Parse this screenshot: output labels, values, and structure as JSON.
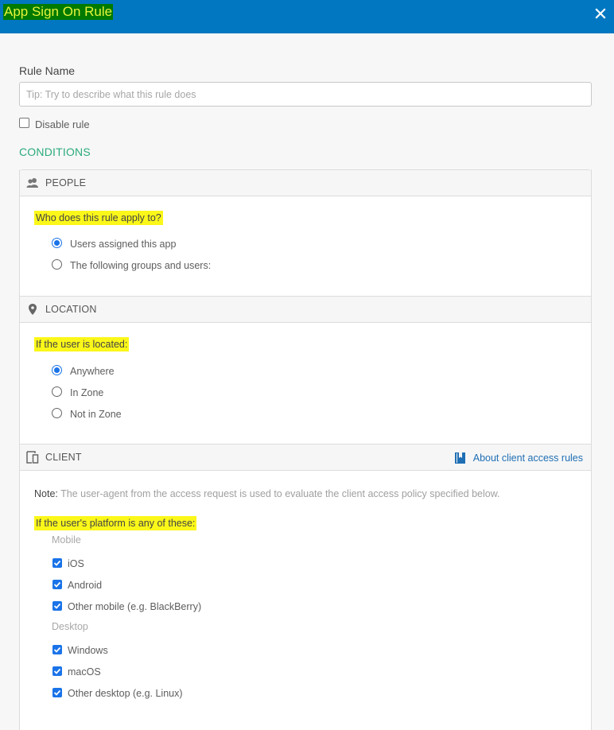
{
  "header": {
    "title": "App Sign On Rule",
    "close_icon": "close-icon"
  },
  "rule_name": {
    "label": "Rule Name",
    "value": "",
    "placeholder": "Tip: Try to describe what this rule does"
  },
  "disable_rule": {
    "label": "Disable rule",
    "checked": false
  },
  "conditions_heading": "CONDITIONS",
  "people": {
    "title": "PEOPLE",
    "icon": "people-icon",
    "question": "Who does this rule apply to?",
    "options": [
      {
        "label": "Users assigned this app",
        "selected": true
      },
      {
        "label": "The following groups and users:",
        "selected": false
      }
    ]
  },
  "location": {
    "title": "LOCATION",
    "icon": "map-pin-icon",
    "question": "If the user is located:",
    "options": [
      {
        "label": "Anywhere",
        "selected": true
      },
      {
        "label": "In Zone",
        "selected": false
      },
      {
        "label": "Not in Zone",
        "selected": false
      }
    ]
  },
  "client": {
    "title": "CLIENT",
    "icon": "devices-icon",
    "help_link": {
      "label": "About client access rules",
      "icon": "book-icon"
    },
    "note_label": "Note:",
    "note_text": " The user-agent from the access request is used to evaluate the client access policy specified below.",
    "question": "If the user's platform is any of these:",
    "groups": [
      {
        "label": "Mobile",
        "items": [
          {
            "label": "iOS",
            "checked": true
          },
          {
            "label": "Android",
            "checked": true
          },
          {
            "label": "Other mobile (e.g. BlackBerry)",
            "checked": true
          }
        ]
      },
      {
        "label": "Desktop",
        "items": [
          {
            "label": "Windows",
            "checked": true
          },
          {
            "label": "macOS",
            "checked": true
          },
          {
            "label": "Other desktop (e.g. Linux)",
            "checked": true
          }
        ]
      }
    ]
  },
  "colors": {
    "header_bg": "#0077c0",
    "accent": "#1a73e8",
    "conditions": "#2bab7c",
    "highlight": "#fbf719",
    "link": "#1f6fb5"
  }
}
